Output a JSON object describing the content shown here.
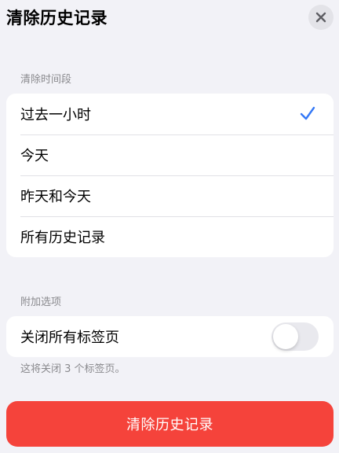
{
  "header": {
    "title": "清除历史记录",
    "close_icon": "close-icon"
  },
  "time_range": {
    "label": "清除时间段",
    "options": [
      {
        "label": "过去一小时",
        "selected": true
      },
      {
        "label": "今天",
        "selected": false
      },
      {
        "label": "昨天和今天",
        "selected": false
      },
      {
        "label": "所有历史记录",
        "selected": false
      }
    ],
    "check_icon": "checkmark-icon"
  },
  "additional": {
    "label": "附加选项",
    "close_tabs_label": "关闭所有标签页",
    "close_tabs_enabled": false,
    "footnote": "这将关闭 3 个标签页。"
  },
  "action": {
    "clear_label": "清除历史记录"
  },
  "colors": {
    "background": "#f2f2f7",
    "accent": "#3478f6",
    "danger": "#f5433b",
    "secondary_text": "#8a8a8e"
  }
}
